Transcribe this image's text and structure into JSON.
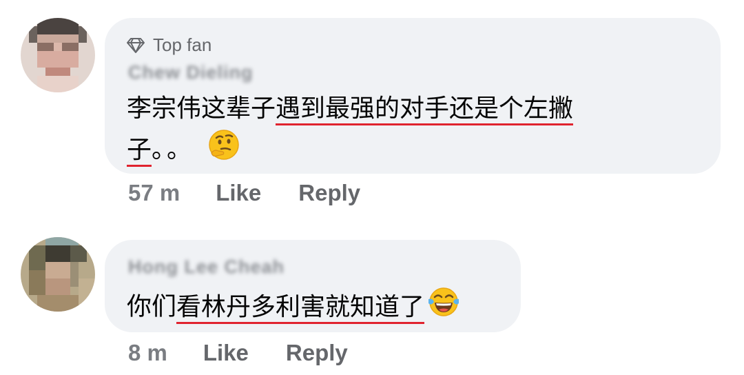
{
  "comments": [
    {
      "badge_label": "Top fan",
      "badge_icon": "diamond-icon",
      "author": "Chew Dieling",
      "text_before": "李宗伟这辈子",
      "text_underlined_1": "遇到最强的对手还是个左撇",
      "text_underlined_2": "子",
      "text_after": "。。",
      "emoji": "thinking-face-emoji",
      "time": "57 m",
      "like_label": "Like",
      "reply_label": "Reply"
    },
    {
      "author": "Hong Lee Cheah",
      "text_before": "你们",
      "text_underlined_1": "看林丹多利害就知道了",
      "emoji": "tears-of-joy-emoji",
      "time": "8 m",
      "like_label": "Like",
      "reply_label": "Reply"
    }
  ],
  "colors": {
    "bubble_bg": "#f0f2f5",
    "secondary_text": "#65676b",
    "underline": "#e0232e",
    "body_text": "#050505"
  }
}
